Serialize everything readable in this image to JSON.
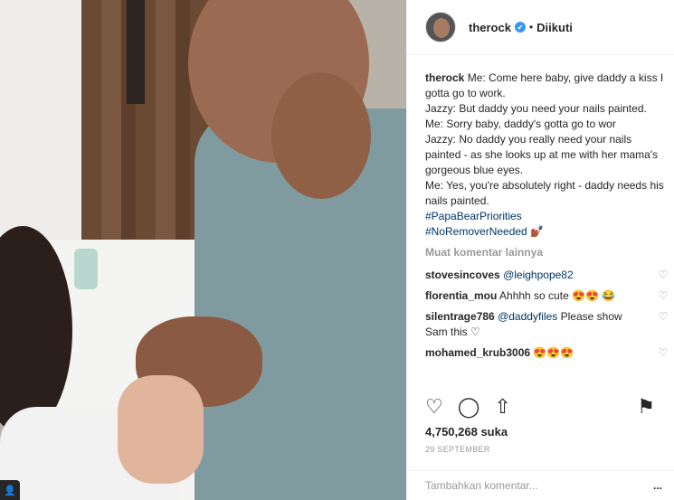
{
  "post": {
    "username": "therock",
    "verified": "✔",
    "follow_status": "Diikuti",
    "caption_user": "therock",
    "caption_lines": [
      "Me: Come here baby, give daddy a kiss I gotta go to work.",
      "Jazzy: But daddy you need your nails painted.",
      "Me: Sorry baby, daddy's gotta go to wor",
      "Jazzy: No daddy you really need your nails painted - as she looks up at me with her mama's gorgeous blue eyes.",
      "Me: Yes, you're absolutely right - daddy needs his nails painted."
    ],
    "hashtags": [
      "#PapaBearPriorities",
      "#NoRemoverNeeded"
    ],
    "hashtag_emoji": "💅🏾",
    "load_more": "Muat komentar lainnya",
    "comments": [
      {
        "user": "stovesincoves",
        "mention": "@leighpope82",
        "text": ""
      },
      {
        "user": "florentia_mou",
        "mention": "",
        "text": "Ahhhh so cute 😍😍 😂"
      },
      {
        "user": "silentrage786",
        "mention": "@daddyfiles",
        "text": "Please show Sam this ♡"
      },
      {
        "user": "mohamed_krub3006",
        "mention": "",
        "text": "😍😍😍"
      }
    ],
    "likes": "4,750,268 suka",
    "date": "29 SEPTEMBER",
    "add_comment_placeholder": "Tambahkan komentar...",
    "more_options": "..."
  },
  "icons": {
    "heart": "♡",
    "comment": "◯",
    "share": "⇧",
    "save": "⚑",
    "user": "👤"
  }
}
